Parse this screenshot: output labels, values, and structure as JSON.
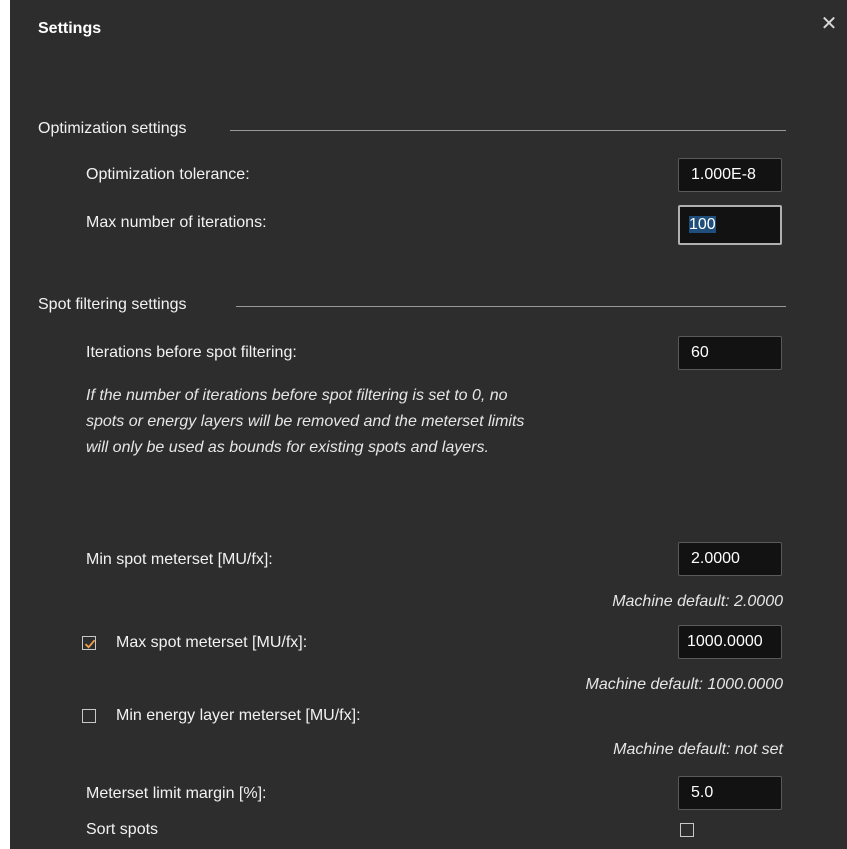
{
  "dialog": {
    "title": "Settings",
    "close_icon": "close-icon"
  },
  "optimization": {
    "section_title": "Optimization settings",
    "tolerance_label": "Optimization tolerance:",
    "tolerance_value": "1.000E-8",
    "max_iterations_label": "Max number of iterations:",
    "max_iterations_value": "100"
  },
  "spot_filtering": {
    "section_title": "Spot filtering settings",
    "iterations_label": "Iterations before spot filtering:",
    "iterations_value": "60",
    "note": "If the number of iterations before spot filtering is set to 0, no spots or energy layers will be removed and the meterset limits will only be used as bounds for existing spots and layers.",
    "min_spot_label": "Min spot meterset [MU/fx]:",
    "min_spot_value": "2.0000",
    "min_spot_default": "Machine default: 2.0000",
    "max_spot_label": "Max spot meterset [MU/fx]:",
    "max_spot_checked": true,
    "max_spot_value": "1000.0000",
    "max_spot_default": "Machine default: 1000.0000",
    "min_energy_label": "Min energy layer meterset [MU/fx]:",
    "min_energy_checked": false,
    "min_energy_default": "Machine default: not set",
    "margin_label": "Meterset limit margin [%]:",
    "margin_value": "5.0",
    "sort_spots_label": "Sort spots",
    "sort_spots_checked": false
  },
  "colors": {
    "panel_bg": "#2d2d2d",
    "field_bg": "#121212",
    "checkmark": "#f0a04b",
    "selection": "#1f4e7a"
  }
}
